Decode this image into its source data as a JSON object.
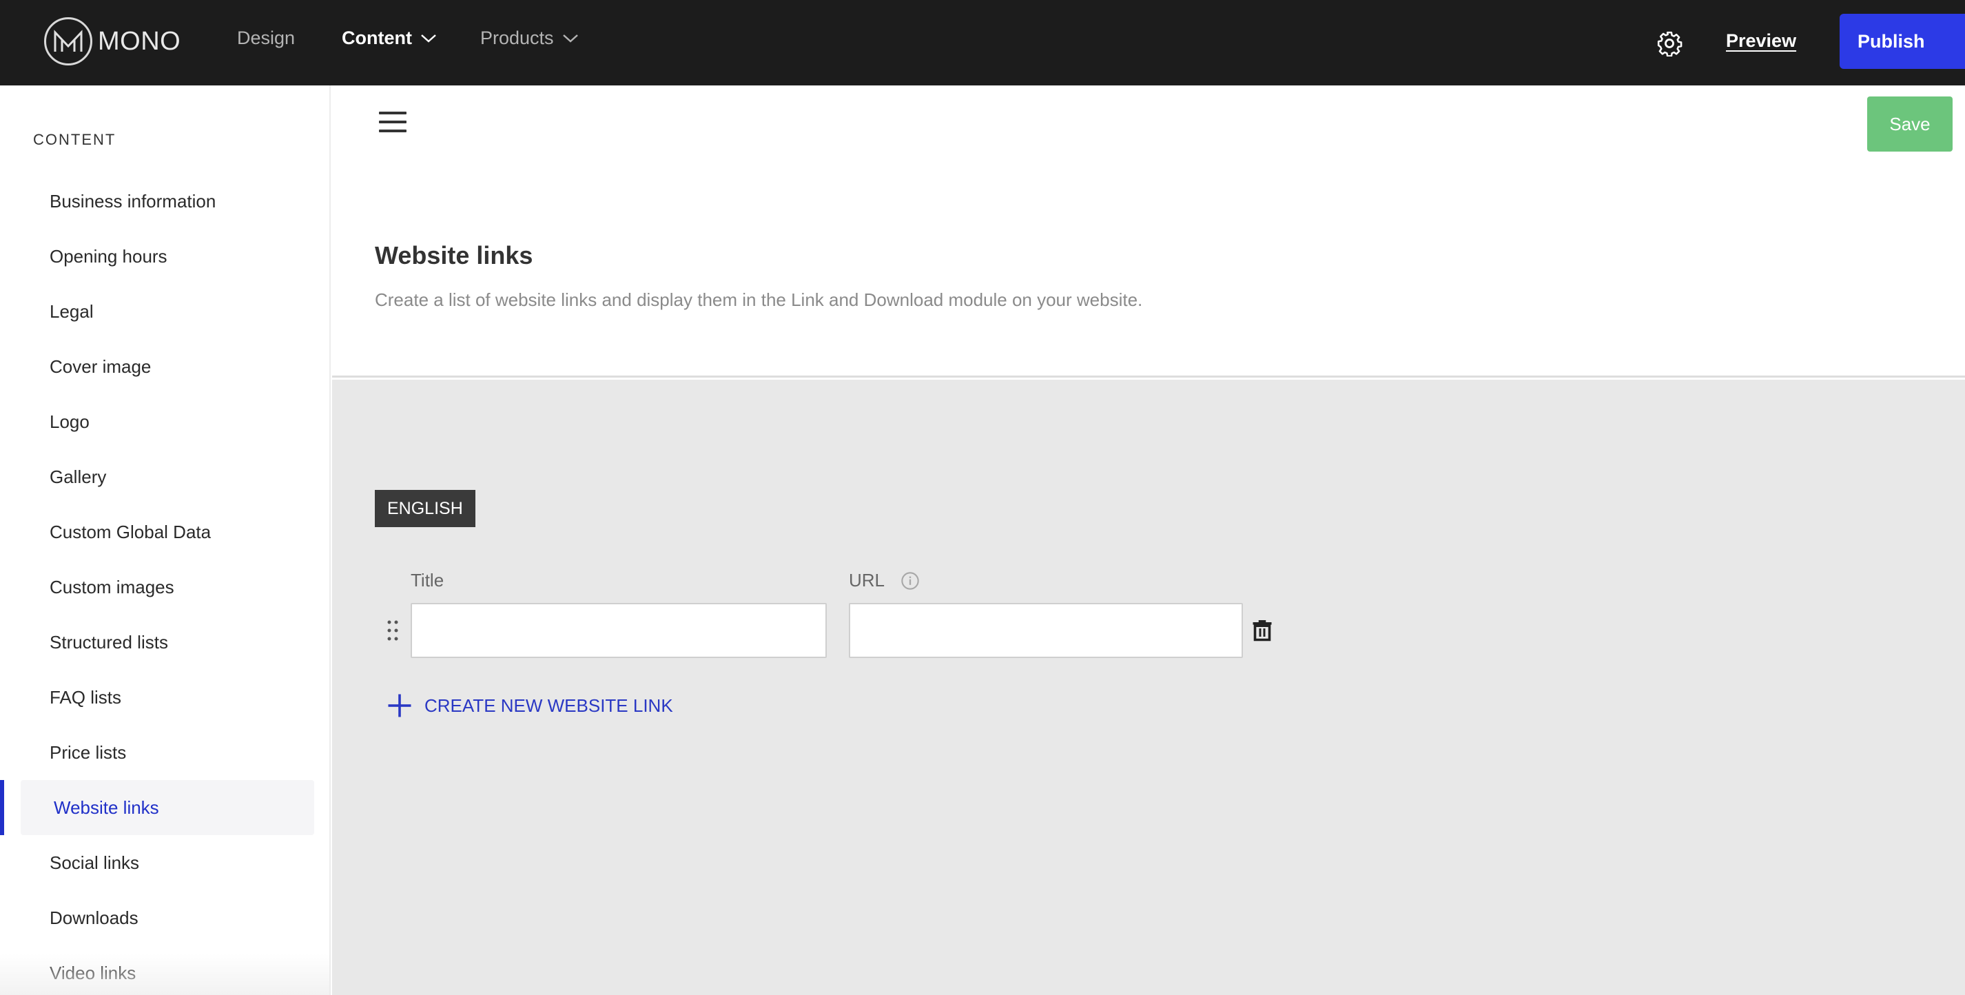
{
  "app": {
    "logo_text": "MONO",
    "colors": {
      "topbar": "#1c1c1c",
      "publish": "#2c3ae6",
      "save": "#6cc57c",
      "accent": "#2030c8",
      "content_bg": "#e8e8e8"
    }
  },
  "topnav": {
    "items": [
      {
        "label": "Design",
        "has_dropdown": false,
        "active": false
      },
      {
        "label": "Content",
        "has_dropdown": true,
        "active": true
      },
      {
        "label": "Products",
        "has_dropdown": true,
        "active": false
      }
    ],
    "settings_icon": "gear-icon",
    "preview_label": "Preview",
    "publish_label": "Publish"
  },
  "sidebar": {
    "heading": "CONTENT",
    "items": [
      {
        "label": "Business information"
      },
      {
        "label": "Opening hours"
      },
      {
        "label": "Legal"
      },
      {
        "label": "Cover image"
      },
      {
        "label": "Logo"
      },
      {
        "label": "Gallery"
      },
      {
        "label": "Custom Global Data"
      },
      {
        "label": "Custom images"
      },
      {
        "label": "Structured lists"
      },
      {
        "label": "FAQ lists"
      },
      {
        "label": "Price lists"
      },
      {
        "label": "Website links"
      },
      {
        "label": "Social links"
      },
      {
        "label": "Downloads"
      },
      {
        "label": "Video links"
      }
    ],
    "active_item": "Website links"
  },
  "header": {
    "menu_icon": "hamburger-icon",
    "save_label": "Save",
    "title": "Website links",
    "description": "Create a list of website links and display them in the Link and Download module on your website."
  },
  "editor": {
    "language": "ENGLISH",
    "title_label": "Title",
    "url_label": "URL",
    "rows": [
      {
        "title": "",
        "url": ""
      }
    ],
    "create_label": "CREATE NEW WEBSITE LINK"
  }
}
